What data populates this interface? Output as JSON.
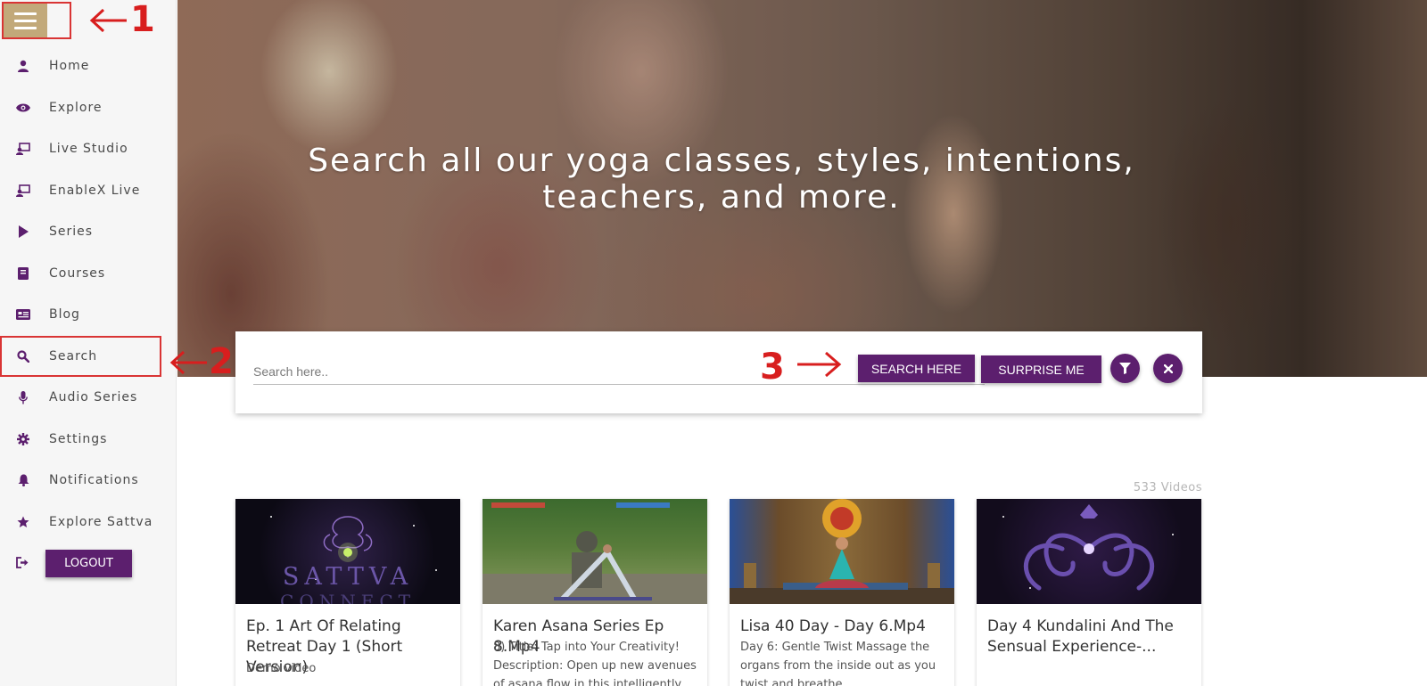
{
  "sidebar": {
    "items": [
      {
        "label": "Home",
        "icon": "user-icon"
      },
      {
        "label": "Explore",
        "icon": "eye-icon"
      },
      {
        "label": "Live Studio",
        "icon": "live-studio-icon"
      },
      {
        "label": "EnableX Live",
        "icon": "live-studio-icon"
      },
      {
        "label": "Series",
        "icon": "play-icon"
      },
      {
        "label": "Courses",
        "icon": "book-icon"
      },
      {
        "label": "Blog",
        "icon": "newspaper-icon"
      },
      {
        "label": "Search",
        "icon": "search-icon"
      },
      {
        "label": "Audio Series",
        "icon": "microphone-icon"
      },
      {
        "label": "Settings",
        "icon": "gear-icon"
      },
      {
        "label": "Notifications",
        "icon": "bell-icon"
      },
      {
        "label": "Explore Sattva",
        "icon": "star-icon"
      }
    ],
    "logout_label": "LOGOUT"
  },
  "annotations": {
    "a1": "1",
    "a2": "2",
    "a3": "3"
  },
  "hero": {
    "title": "Search all our yoga classes, styles, intentions, teachers, and more."
  },
  "search": {
    "placeholder": "Search here..",
    "search_button": "SEARCH HERE",
    "surprise_button": "SURPRISE ME"
  },
  "videos": {
    "count": "533 Videos",
    "cards": [
      {
        "title": "Ep. 1 Art Of Relating Retreat Day 1 (Short Version)",
        "desc": "Demo video",
        "thumb_text": "SATTVA",
        "thumb_subtext": "CONNECT"
      },
      {
        "title": "Karen Asana Series Ep 8.Mp4",
        "desc": "8) Title: Tap into Your Creativity! Description: Open up new avenues of asana flow in this intelligently"
      },
      {
        "title": "Lisa 40 Day - Day 6.Mp4",
        "desc": "Day 6: Gentle Twist Massage the organs from the inside out as you twist and breathe."
      },
      {
        "title": "Day 4 Kundalini And The Sensual Experience-...",
        "desc": ""
      }
    ]
  },
  "colors": {
    "brand_purple": "#5c1f6e",
    "annotation_red": "#d81e1e",
    "toggle_gold": "#c2a97a"
  }
}
